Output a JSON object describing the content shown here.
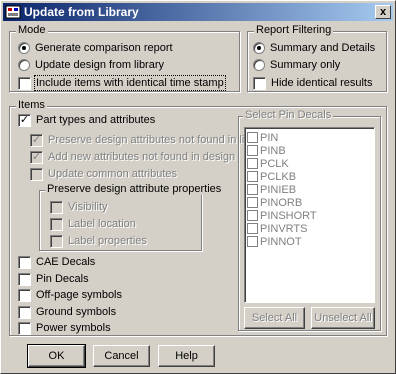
{
  "window": {
    "title": "Update from Library",
    "close_label": "x"
  },
  "mode": {
    "legend": "Mode",
    "options": [
      {
        "label": "Generate comparison report",
        "selected": true
      },
      {
        "label": "Update design from library",
        "selected": false
      }
    ],
    "identical_stamp": {
      "label": "Include items with identical time stamp",
      "checked": false
    }
  },
  "report_filtering": {
    "legend": "Report Filtering",
    "options": [
      {
        "label": "Summary and Details",
        "selected": true
      },
      {
        "label": "Summary only",
        "selected": false
      }
    ],
    "hide_identical": {
      "label": "Hide identical results",
      "checked": false
    }
  },
  "items": {
    "legend": "Items",
    "part_types": {
      "label": "Part types and attributes",
      "checked": true
    },
    "sub_options": [
      {
        "label": "Preserve design attributes not found in library",
        "checked": true
      },
      {
        "label": "Add new attributes not found in design",
        "checked": true
      },
      {
        "label": "Update common attributes",
        "checked": false
      }
    ],
    "preserve_props": {
      "legend": "Preserve design attribute properties",
      "options": [
        {
          "label": "Visibility",
          "checked": false
        },
        {
          "label": "Label location",
          "checked": false
        },
        {
          "label": "Label properties",
          "checked": false
        }
      ]
    },
    "others": [
      {
        "label": "CAE Decals",
        "checked": false
      },
      {
        "label": "Pin Decals",
        "checked": false
      },
      {
        "label": "Off-page symbols",
        "checked": false
      },
      {
        "label": "Ground symbols",
        "checked": false
      },
      {
        "label": "Power symbols",
        "checked": false
      }
    ]
  },
  "pin_decals": {
    "legend": "Select Pin Decals",
    "items": [
      "PIN",
      "PINB",
      "PCLK",
      "PCLKB",
      "PINIEB",
      "PINORB",
      "PINSHORT",
      "PINVRTS",
      "PINNOT"
    ],
    "select_all": "Select All",
    "unselect_all": "Unselect All"
  },
  "buttons": {
    "ok": "OK",
    "cancel": "Cancel",
    "help": "Help"
  }
}
